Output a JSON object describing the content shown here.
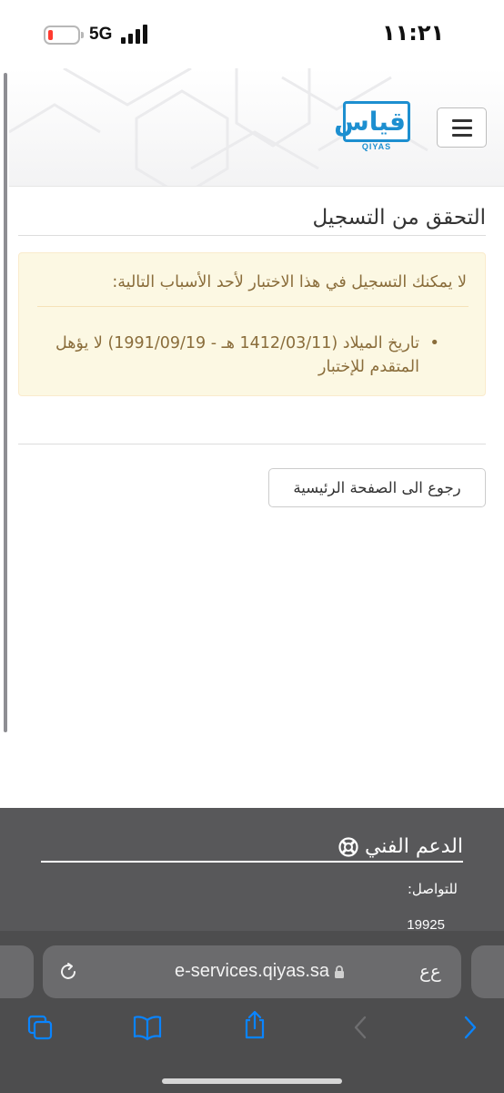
{
  "status_bar": {
    "time": "١١:٢١",
    "network": "5G",
    "battery_level": 0.1,
    "battery_color": "#ff3b30"
  },
  "header": {
    "logo_text": "QIYAS",
    "logo_glyph": "قياس",
    "menu_icon": "hamburger-menu-icon",
    "brand_color": "#1d8fd0"
  },
  "main": {
    "page_title": "التحقق من التسجيل",
    "alert": {
      "heading": "لا يمكنك التسجيل في هذا الاختبار لأحد الأسباب التالية:",
      "reasons": [
        "تاريخ الميلاد (1412/03/11 هـ - 1991/09/19) لا يؤهل المتقدم للإختبار"
      ],
      "background_color": "#fcf8e3",
      "text_color": "#8a6d3b"
    },
    "back_button_label": "رجوع الى الصفحة الرئيسية"
  },
  "footer": {
    "support_heading": "الدعم الفني",
    "support_icon": "lifebuoy-icon",
    "contact_label": "للتواصل:",
    "contact_phone": "19925"
  },
  "browser": {
    "url": "e-services.qiyas.sa",
    "reader_label": "ﻉﻉ",
    "toolbar_icons": [
      "tabs-icon",
      "bookmarks-icon",
      "share-icon",
      "back-icon",
      "forward-icon"
    ],
    "accent_color": "#0a84ff"
  }
}
